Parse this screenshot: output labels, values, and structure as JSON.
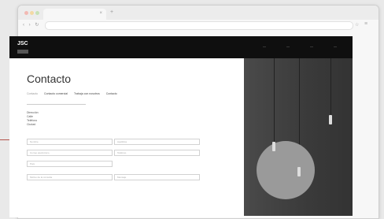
{
  "browser": {
    "tab_close": "×",
    "new_tab": "+",
    "nav_glyphs": "‹ › ↻",
    "star": "☆",
    "menu": "≡"
  },
  "header": {
    "logo": "JSC",
    "nav": [
      "—",
      "—",
      "—",
      "—"
    ]
  },
  "page": {
    "title": "Contacto",
    "subnav": [
      "Contacto",
      "Contacto comercial",
      "Trabaja con nosotros",
      "Contacto"
    ],
    "address": [
      "Dirección",
      "Calle",
      "Teléfono",
      "Ciudad"
    ]
  },
  "form": {
    "fields": [
      "Nombre",
      "Apellidos",
      "Correo electrónico",
      "Teléfono",
      "País",
      "Motivo de la consulta",
      "Mensaje"
    ]
  }
}
